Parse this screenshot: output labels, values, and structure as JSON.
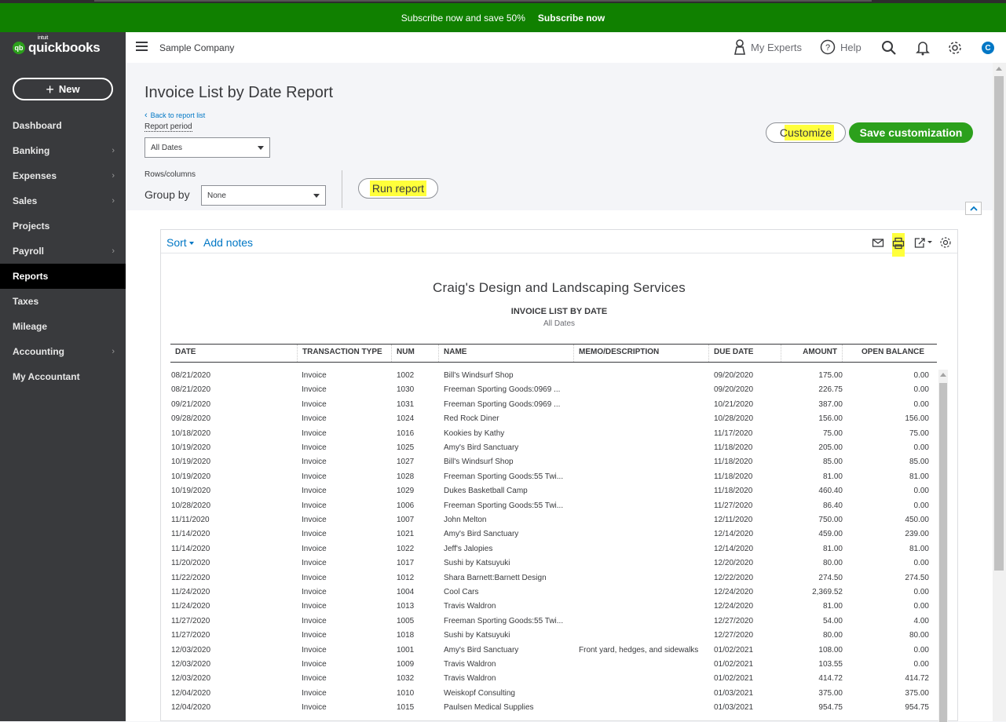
{
  "promo": {
    "text": "Subscribe now and save 50%",
    "cta": "Subscribe now"
  },
  "logo": {
    "intuit": "intuit",
    "word": "quickbooks",
    "badge": "qb"
  },
  "sidebar": {
    "new_label": "New",
    "items": [
      {
        "label": "Dashboard",
        "chevron": false
      },
      {
        "label": "Banking",
        "chevron": true
      },
      {
        "label": "Expenses",
        "chevron": true
      },
      {
        "label": "Sales",
        "chevron": true
      },
      {
        "label": "Projects",
        "chevron": false
      },
      {
        "label": "Payroll",
        "chevron": true
      },
      {
        "label": "Reports",
        "chevron": false,
        "active": true
      },
      {
        "label": "Taxes",
        "chevron": false
      },
      {
        "label": "Mileage",
        "chevron": false
      },
      {
        "label": "Accounting",
        "chevron": true
      },
      {
        "label": "My Accountant",
        "chevron": false
      }
    ]
  },
  "header": {
    "company": "Sample Company",
    "my_experts": "My Experts",
    "help": "Help",
    "avatar_initial": "C"
  },
  "page": {
    "title": "Invoice List by Date Report",
    "back_link": "Back to report list",
    "report_period_label": "Report period",
    "report_period_value": "All Dates",
    "rows_columns_label": "Rows/columns",
    "group_by_label": "Group by",
    "group_by_value": "None",
    "run_report": "Run report",
    "customize": "Customize",
    "save_customization": "Save customization"
  },
  "toolbar": {
    "sort": "Sort",
    "add_notes": "Add notes"
  },
  "report": {
    "company_name": "Craig's Design and Landscaping Services",
    "title": "INVOICE LIST BY DATE",
    "period": "All Dates",
    "columns": [
      "DATE",
      "TRANSACTION TYPE",
      "NUM",
      "NAME",
      "MEMO/DESCRIPTION",
      "DUE DATE",
      "AMOUNT",
      "OPEN BALANCE"
    ],
    "rows": [
      [
        "08/21/2020",
        "Invoice",
        "1002",
        "Bill's Windsurf Shop",
        "",
        "09/20/2020",
        "175.00",
        "0.00"
      ],
      [
        "08/21/2020",
        "Invoice",
        "1030",
        "Freeman Sporting Goods:0969 ...",
        "",
        "09/20/2020",
        "226.75",
        "0.00"
      ],
      [
        "09/21/2020",
        "Invoice",
        "1031",
        "Freeman Sporting Goods:0969 ...",
        "",
        "10/21/2020",
        "387.00",
        "0.00"
      ],
      [
        "09/28/2020",
        "Invoice",
        "1024",
        "Red Rock Diner",
        "",
        "10/28/2020",
        "156.00",
        "156.00"
      ],
      [
        "10/18/2020",
        "Invoice",
        "1016",
        "Kookies by Kathy",
        "",
        "11/17/2020",
        "75.00",
        "75.00"
      ],
      [
        "10/19/2020",
        "Invoice",
        "1025",
        "Amy's Bird Sanctuary",
        "",
        "11/18/2020",
        "205.00",
        "0.00"
      ],
      [
        "10/19/2020",
        "Invoice",
        "1027",
        "Bill's Windsurf Shop",
        "",
        "11/18/2020",
        "85.00",
        "85.00"
      ],
      [
        "10/19/2020",
        "Invoice",
        "1028",
        "Freeman Sporting Goods:55 Twi...",
        "",
        "11/18/2020",
        "81.00",
        "81.00"
      ],
      [
        "10/19/2020",
        "Invoice",
        "1029",
        "Dukes Basketball Camp",
        "",
        "11/18/2020",
        "460.40",
        "0.00"
      ],
      [
        "10/28/2020",
        "Invoice",
        "1006",
        "Freeman Sporting Goods:55 Twi...",
        "",
        "11/27/2020",
        "86.40",
        "0.00"
      ],
      [
        "11/11/2020",
        "Invoice",
        "1007",
        "John Melton",
        "",
        "12/11/2020",
        "750.00",
        "450.00"
      ],
      [
        "11/14/2020",
        "Invoice",
        "1021",
        "Amy's Bird Sanctuary",
        "",
        "12/14/2020",
        "459.00",
        "239.00"
      ],
      [
        "11/14/2020",
        "Invoice",
        "1022",
        "Jeff's Jalopies",
        "",
        "12/14/2020",
        "81.00",
        "81.00"
      ],
      [
        "11/20/2020",
        "Invoice",
        "1017",
        "Sushi by Katsuyuki",
        "",
        "12/20/2020",
        "80.00",
        "0.00"
      ],
      [
        "11/22/2020",
        "Invoice",
        "1012",
        "Shara Barnett:Barnett Design",
        "",
        "12/22/2020",
        "274.50",
        "274.50"
      ],
      [
        "11/24/2020",
        "Invoice",
        "1004",
        "Cool Cars",
        "",
        "12/24/2020",
        "2,369.52",
        "0.00"
      ],
      [
        "11/24/2020",
        "Invoice",
        "1013",
        "Travis Waldron",
        "",
        "12/24/2020",
        "81.00",
        "0.00"
      ],
      [
        "11/27/2020",
        "Invoice",
        "1005",
        "Freeman Sporting Goods:55 Twi...",
        "",
        "12/27/2020",
        "54.00",
        "4.00"
      ],
      [
        "11/27/2020",
        "Invoice",
        "1018",
        "Sushi by Katsuyuki",
        "",
        "12/27/2020",
        "80.00",
        "80.00"
      ],
      [
        "12/03/2020",
        "Invoice",
        "1001",
        "Amy's Bird Sanctuary",
        "Front yard, hedges, and sidewalks",
        "01/02/2021",
        "108.00",
        "0.00"
      ],
      [
        "12/03/2020",
        "Invoice",
        "1009",
        "Travis Waldron",
        "",
        "01/02/2021",
        "103.55",
        "0.00"
      ],
      [
        "12/03/2020",
        "Invoice",
        "1032",
        "Travis Waldron",
        "",
        "01/02/2021",
        "414.72",
        "414.72"
      ],
      [
        "12/04/2020",
        "Invoice",
        "1010",
        "Weiskopf Consulting",
        "",
        "01/03/2021",
        "375.00",
        "375.00"
      ],
      [
        "12/04/2020",
        "Invoice",
        "1015",
        "Paulsen Medical Supplies",
        "",
        "01/03/2021",
        "954.75",
        "954.75"
      ]
    ]
  },
  "colors": {
    "promo": "#108000",
    "sidebar": "#393a3d",
    "accent": "#0077c5",
    "primary_button": "#2ca01c",
    "highlight": "#ffff3b"
  }
}
